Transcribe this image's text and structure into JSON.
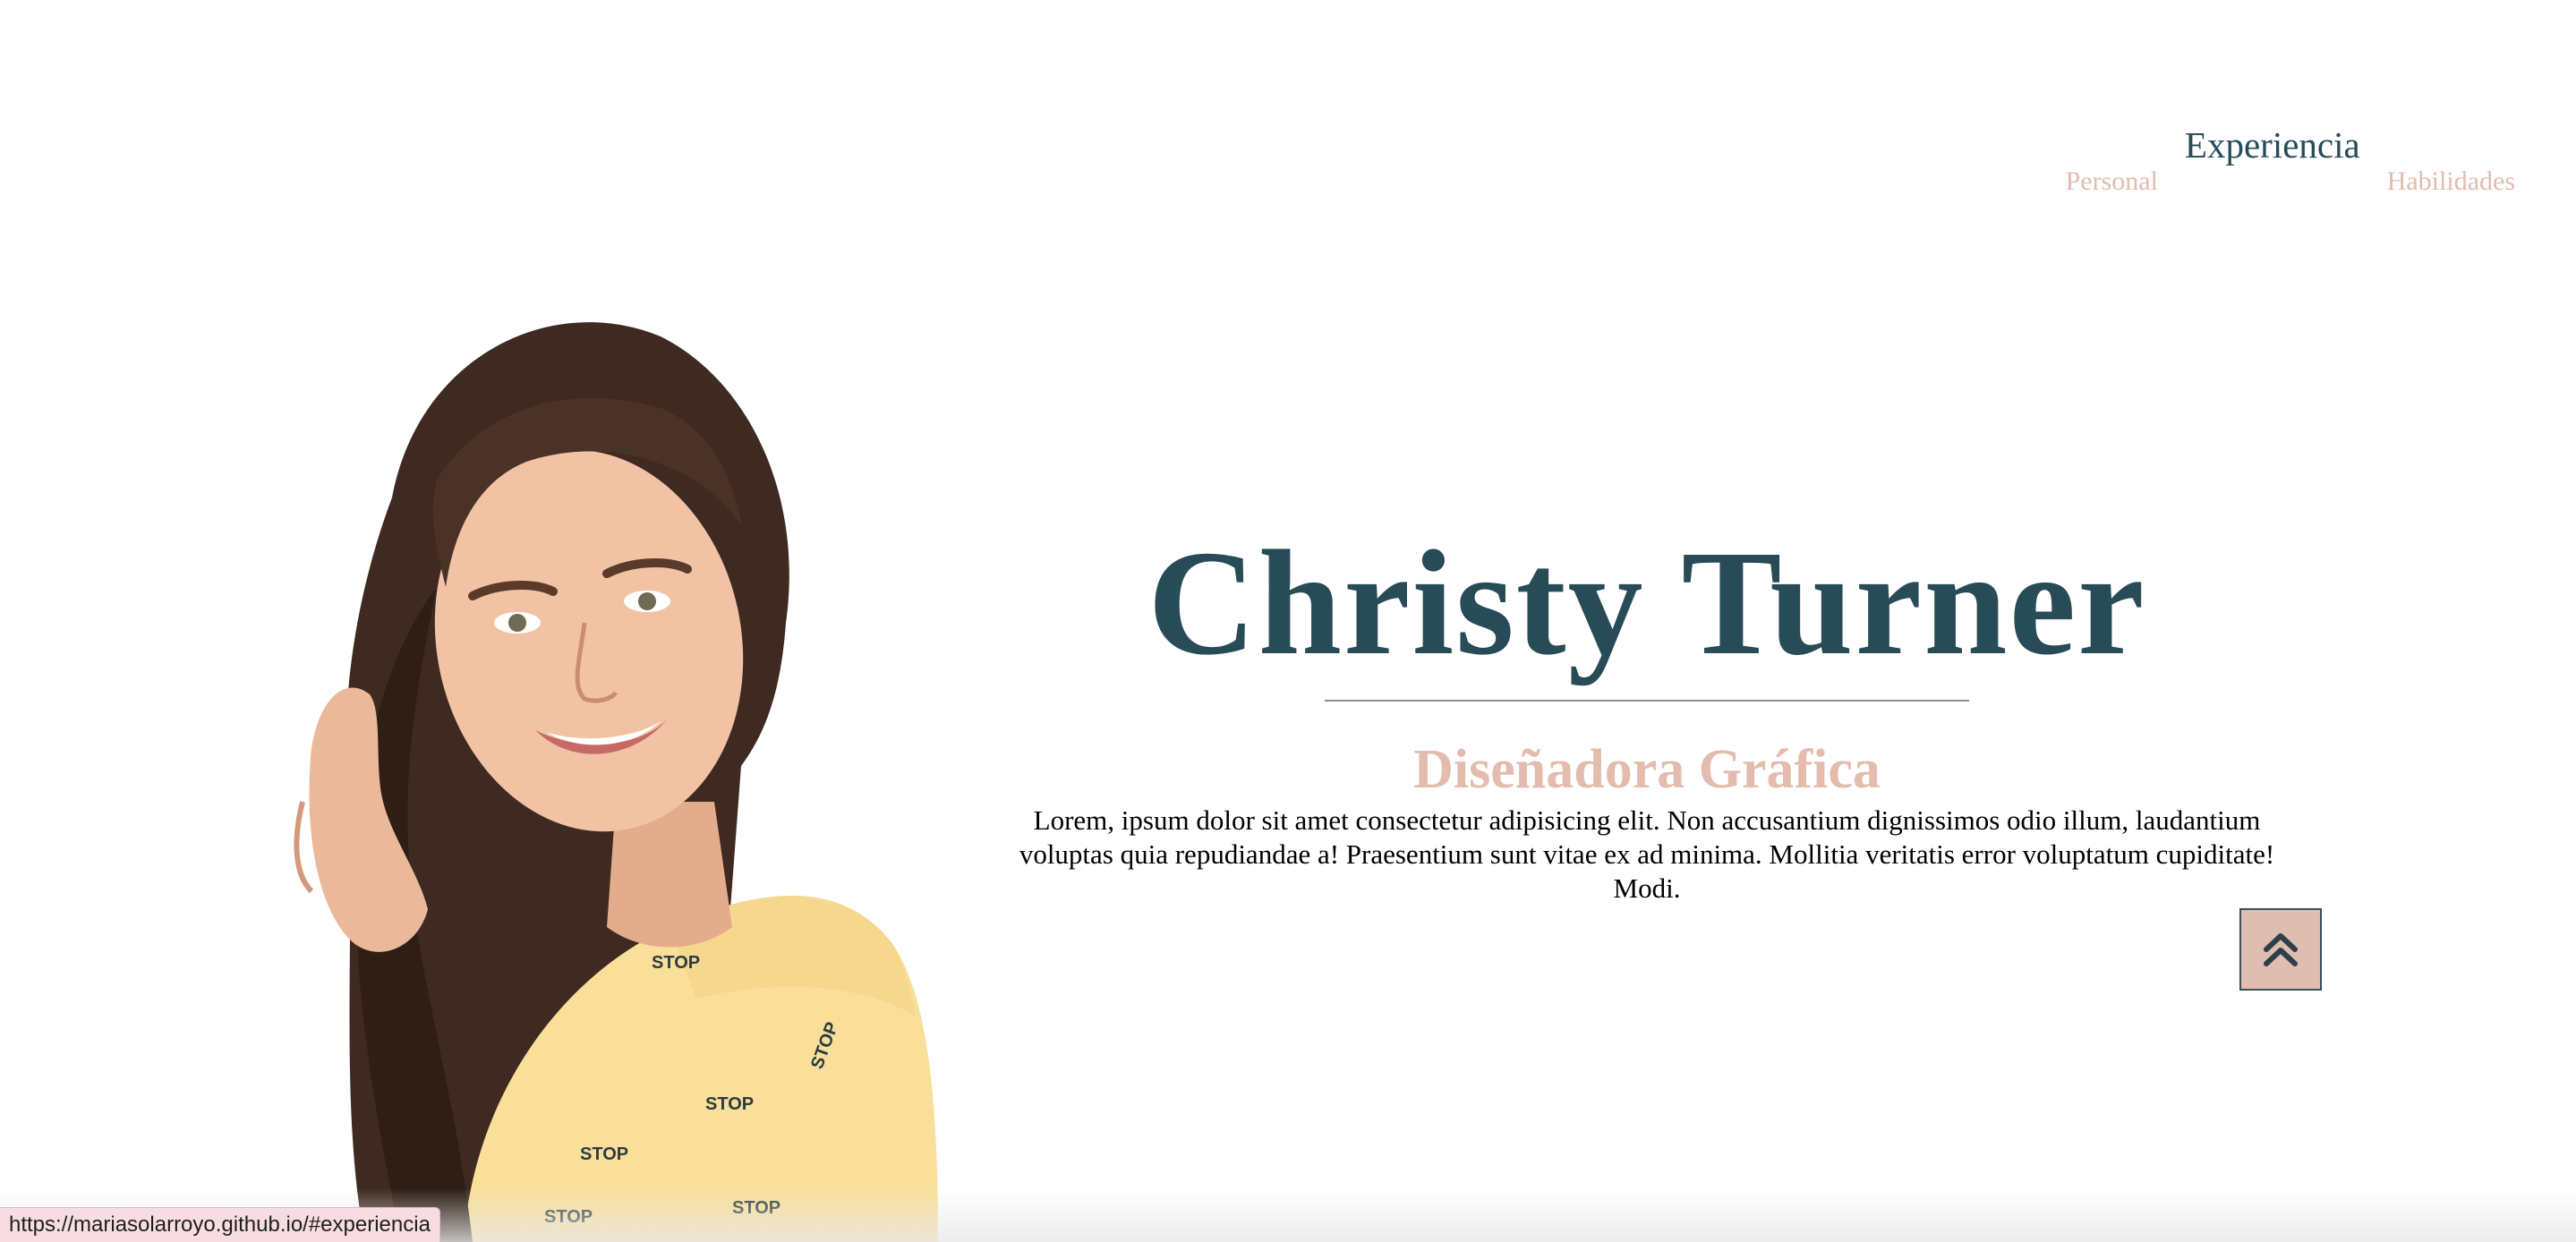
{
  "nav": {
    "items": [
      {
        "label": "Personal",
        "active": false
      },
      {
        "label": "Experiencia",
        "active": true
      },
      {
        "label": "Habilidades",
        "active": false
      }
    ]
  },
  "hero": {
    "name": "Christy Turner",
    "role": "Diseñadora Gráfica",
    "description": "Lorem, ipsum dolor sit amet consectetur adipisicing elit. Non accusantium dignissimos odio illum, laudantium voluptas quia repudiandae a! Praesentium sunt vitae ex ad minima. Mollitia veritatis error voluptatum cupiditate! Modi.",
    "portrait_shirt_text": "STOP"
  },
  "back_to_top": {
    "icon": "double-chevron-up-icon"
  },
  "status_bar": {
    "url": "https://mariasolarroyo.github.io/#experiencia"
  },
  "colors": {
    "primary": "#284b58",
    "accent": "#e3bcae",
    "button_bg": "#e0bdb1",
    "text": "#000000",
    "background": "#ffffff"
  }
}
